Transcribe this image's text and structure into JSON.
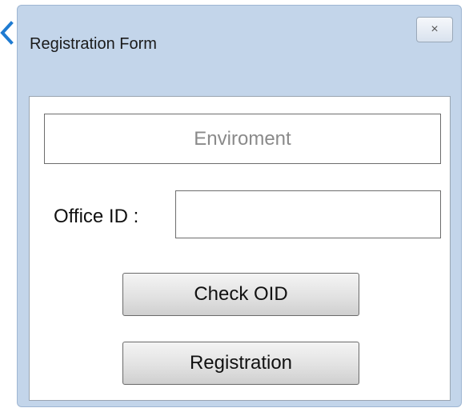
{
  "window": {
    "title": "Registration Form",
    "close_glyph": "×"
  },
  "form": {
    "environment_label": "Enviroment",
    "office_id_label": "Office ID :",
    "office_id_value": "",
    "check_button_label": "Check OID",
    "registration_button_label": "Registration"
  },
  "icons": {
    "back": "chevron-left-icon",
    "close": "close-icon"
  },
  "colors": {
    "window_bg": "#c3d5ea",
    "accent": "#1f7bd1"
  }
}
